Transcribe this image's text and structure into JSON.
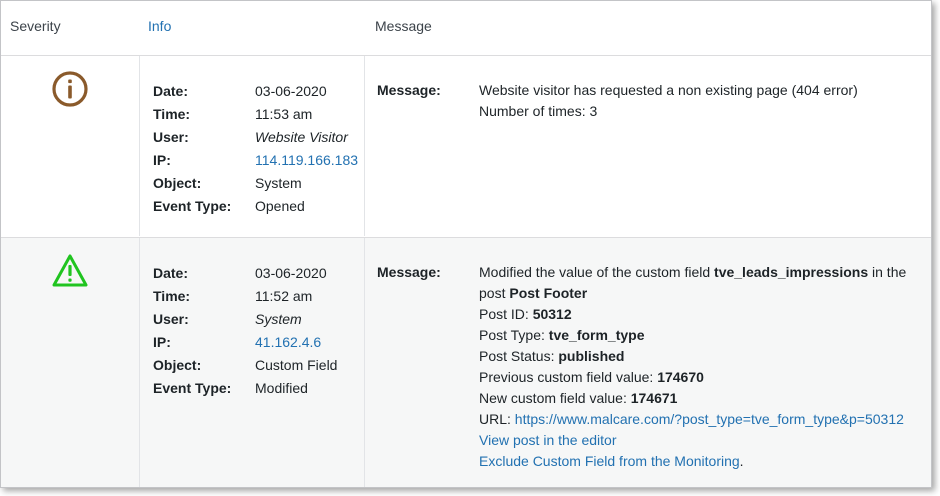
{
  "header": {
    "severity": "Severity",
    "info": "Info",
    "message": "Message"
  },
  "labels": {
    "date": "Date:",
    "time": "Time:",
    "user": "User:",
    "ip": "IP:",
    "object": "Object:",
    "event_type": "Event Type:",
    "message": "Message:"
  },
  "colors": {
    "info_icon": "#8a5a2b",
    "warning_icon": "#20c420",
    "link": "#2271b1"
  },
  "rows": [
    {
      "severity_icon": "info-circle-icon",
      "date": "03-06-2020",
      "time": "11:53 am",
      "user": "Website Visitor",
      "ip": "114.119.166.183",
      "object": "System",
      "event_type": "Opened",
      "message": {
        "line1": "Website visitor has requested a non existing page (404 error)",
        "line2": "Number of times: 3"
      }
    },
    {
      "severity_icon": "warning-triangle-icon",
      "date": "03-06-2020",
      "time": "11:52 am",
      "user": "System",
      "ip": "41.162.4.6",
      "object": "Custom Field",
      "event_type": "Modified",
      "message": {
        "intro": "Modified the value of the custom field",
        "field_name": "tve_leads_impressions",
        "in_the": "in the",
        "post_prefix": "post",
        "post_title": "Post Footer",
        "post_id_label": "Post ID:",
        "post_id": "50312",
        "post_type_label": "Post Type:",
        "post_type": "tve_form_type",
        "post_status_label": "Post Status:",
        "post_status": "published",
        "prev_label": "Previous custom field value:",
        "prev_value": "174670",
        "new_label": "New custom field value:",
        "new_value": "174671",
        "url_label": "URL:",
        "url": "https://www.malcare.com/?post_type=tve_form_type&p=50312",
        "view_link": "View post in the editor",
        "exclude_link": "Exclude Custom Field from the Monitoring",
        "period": "."
      }
    }
  ]
}
